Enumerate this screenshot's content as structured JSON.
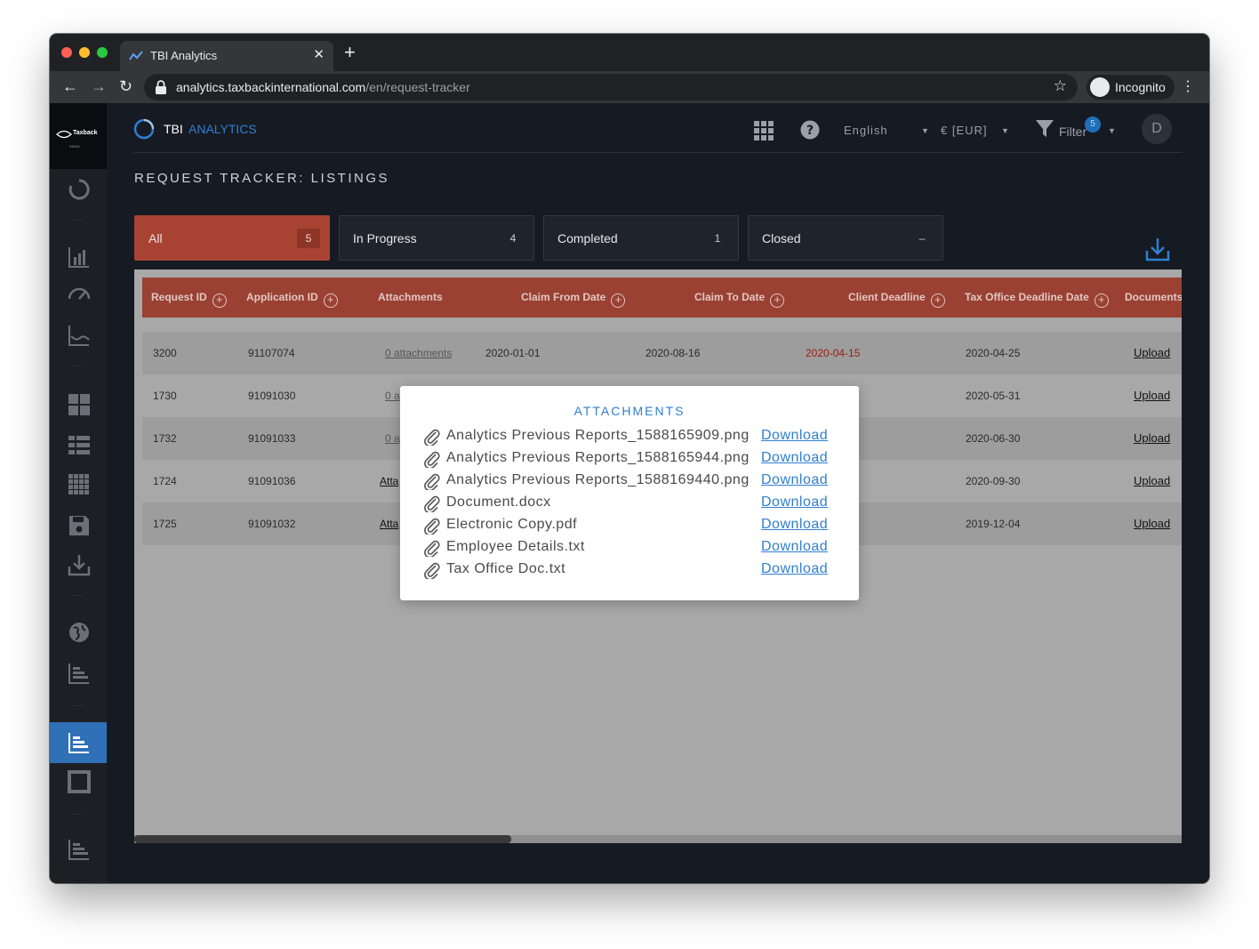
{
  "browser": {
    "tab_title": "TBI Analytics",
    "close_symbol": "✕",
    "new_tab_symbol": "+",
    "url_host": "analytics.taxbackinternational.com",
    "url_path": "/en/request-tracker",
    "profile_label": "Incognito"
  },
  "app": {
    "logo_text": "Taxback",
    "logo_sub": "DEMO",
    "brand_tbi": "TBI",
    "brand_analytics": "ANALYTICS",
    "language": "English",
    "currency": "€ [EUR]",
    "filter_label": "Filter",
    "filter_count": "5",
    "avatar_initial": "D",
    "page_title": "REQUEST TRACKER: LISTINGS"
  },
  "status_tabs": [
    {
      "label": "All",
      "count": "5"
    },
    {
      "label": "In Progress",
      "count": "4"
    },
    {
      "label": "Completed",
      "count": "1"
    },
    {
      "label": "Closed",
      "count": "–"
    }
  ],
  "table": {
    "columns": [
      "Request ID",
      "Application ID",
      "Attachments",
      "Claim From Date",
      "Claim To Date",
      "Client Deadline",
      "Tax Office Deadline Date",
      "Documents"
    ],
    "rows": [
      {
        "request_id": "3200",
        "application_id": "91107074",
        "attachments": "0 attachments",
        "claim_from": "2020-01-01",
        "claim_to": "2020-08-16",
        "client_deadline": "2020-04-15",
        "tax_office_deadline": "2020-04-25",
        "documents": "Upload"
      },
      {
        "request_id": "1730",
        "application_id": "91091030",
        "attachments": "0 a",
        "claim_from": "",
        "claim_to": "",
        "client_deadline": "",
        "tax_office_deadline": "2020-05-31",
        "documents": "Upload"
      },
      {
        "request_id": "1732",
        "application_id": "91091033",
        "attachments": "0 a",
        "claim_from": "",
        "claim_to": "",
        "client_deadline": "",
        "tax_office_deadline": "2020-06-30",
        "documents": "Upload"
      },
      {
        "request_id": "1724",
        "application_id": "91091036",
        "attachments": "Atta",
        "claim_from": "",
        "claim_to": "",
        "client_deadline": "",
        "tax_office_deadline": "2020-09-30",
        "documents": "Upload"
      },
      {
        "request_id": "1725",
        "application_id": "91091032",
        "attachments": "Atta",
        "claim_from": "",
        "claim_to": "",
        "client_deadline": "",
        "tax_office_deadline": "2019-12-04",
        "documents": "Upload"
      }
    ]
  },
  "modal": {
    "title": "ATTACHMENTS",
    "download_label": "Download",
    "files": [
      "Analytics Previous Reports_1588165909.png",
      "Analytics Previous Reports_1588165944.png",
      "Analytics Previous Reports_1588169440.png",
      "Document.docx",
      "Electronic Copy.pdf",
      "Employee Details.txt",
      "Tax Office Doc.txt"
    ]
  },
  "colors": {
    "accent": "#2f7fd1",
    "active_tab": "#a84333",
    "table_header": "#9a4134",
    "deadline_warning": "#9b1c12"
  }
}
